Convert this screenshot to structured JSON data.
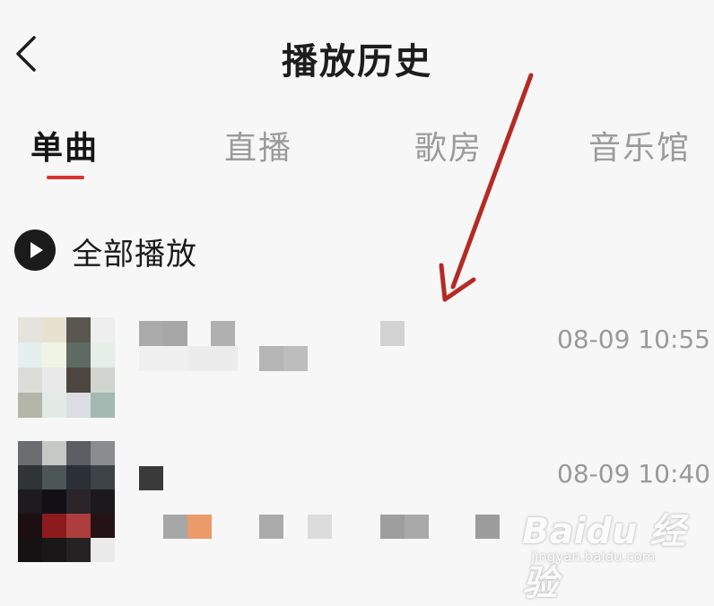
{
  "header": {
    "title": "播放历史",
    "back_icon": "chevron-left-icon"
  },
  "tabs": [
    {
      "label": "单曲",
      "active": true
    },
    {
      "label": "直播",
      "active": false
    },
    {
      "label": "歌房",
      "active": false
    },
    {
      "label": "音乐馆",
      "active": false
    }
  ],
  "play_all": {
    "label": "全部播放",
    "icon": "play-circle-icon"
  },
  "songs": [
    {
      "time": "08-09 10:55"
    },
    {
      "time": "08-09 10:40"
    }
  ],
  "colors": {
    "accent": "#d9332f",
    "annotation_arrow": "#b52a26",
    "text_primary": "#1c1c1c",
    "text_secondary": "#9b9b9b"
  },
  "watermark": {
    "logo": "Baidu 经验",
    "sub": "jingyan.baidu.com"
  }
}
